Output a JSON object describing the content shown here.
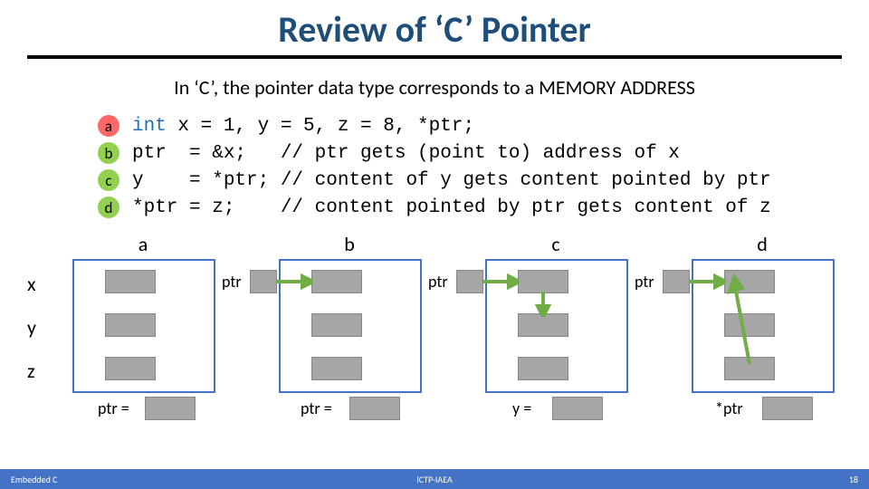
{
  "title": "Review of ‘C’ Pointer",
  "intro": "In ‘C’, the pointer data type corresponds to a MEMORY ADDRESS",
  "bullets": [
    {
      "id": "a",
      "color": "red"
    },
    {
      "id": "b",
      "color": "green"
    },
    {
      "id": "c",
      "color": "green"
    },
    {
      "id": "d",
      "color": "green"
    }
  ],
  "code": {
    "a_kw": "int",
    "a_rest": " x = 1, y = 5, z = 8, *ptr;",
    "b": "ptr  = &x;   // ptr gets (point to) address of x",
    "c": "y    = *ptr; // content of y gets content pointed by ptr",
    "d": "*ptr = z;    // content pointed by ptr gets content of z"
  },
  "rows": {
    "x": "x",
    "y": "y",
    "z": "z"
  },
  "cols": {
    "a": "a",
    "b": "b",
    "c": "c",
    "d": "d"
  },
  "ptr_label": "ptr",
  "bottom": {
    "a": "ptr =",
    "b": "ptr =",
    "c": "y =",
    "d": "*ptr"
  },
  "footer": {
    "left": "Embedded C",
    "center": "ICTP-IAEA",
    "right": "18"
  }
}
